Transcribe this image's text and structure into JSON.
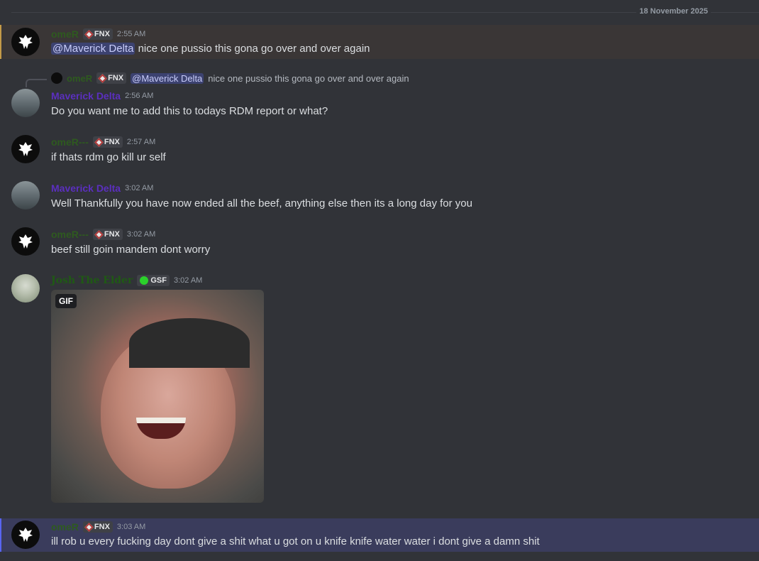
{
  "date_divider": "18 November 2025",
  "tags": {
    "fnx": "FNX",
    "gsf": "GSF"
  },
  "gif_badge": "GIF",
  "messages": [
    {
      "username": "omeR",
      "timestamp": "2:55 AM",
      "mention": "@Maverick Delta",
      "text": "nice one pussio this gona go over and over again"
    },
    {
      "username": "Maverick Delta",
      "timestamp": "2:56 AM",
      "text": "Do you want me to add this to todays RDM report or what?",
      "reply": {
        "username": "omeR",
        "mention": "@Maverick Delta",
        "text": "nice one pussio this gona go over and over again"
      }
    },
    {
      "username": "omeR---",
      "timestamp": "2:57 AM",
      "text": "if thats rdm go kill ur self"
    },
    {
      "username": "Maverick Delta",
      "timestamp": "3:02 AM",
      "text": "Well Thankfully you have now ended all the beef, anything else then its a long day for you"
    },
    {
      "username": "omeR---",
      "timestamp": "3:02 AM",
      "text": "beef still goin mandem dont worry"
    },
    {
      "username": "Josh The Elder",
      "timestamp": "3:02 AM"
    },
    {
      "username": "omeR",
      "timestamp": "3:03 AM",
      "text": "ill rob u every fucking day dont give a shit what u got on u knife knife water water i dont give a damn shit"
    }
  ]
}
